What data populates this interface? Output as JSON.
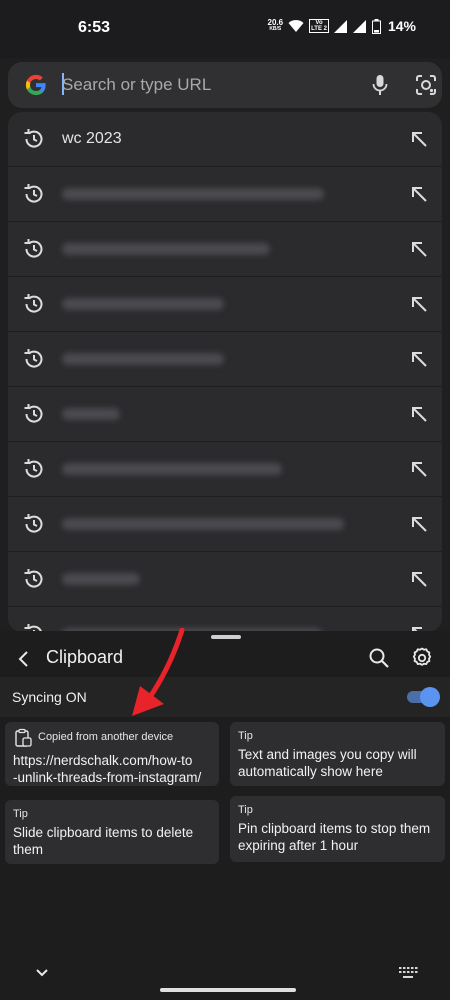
{
  "status_bar": {
    "time": "6:53",
    "net_speed_value": "20.6",
    "net_speed_unit": "KB/S",
    "volte_top": "Vo",
    "volte_bottom": "LTE 2",
    "battery_percent": "14%"
  },
  "search": {
    "placeholder": "Search or type URL",
    "mic_icon": "mic-icon",
    "lens_icon": "lens-icon"
  },
  "suggestions": [
    {
      "text": "wc 2023",
      "blurred": false
    },
    {
      "text": "",
      "blurred": true
    },
    {
      "text": "",
      "blurred": true
    },
    {
      "text": "",
      "blurred": true
    },
    {
      "text": "",
      "blurred": true
    },
    {
      "text": "",
      "blurred": true
    },
    {
      "text": "",
      "blurred": true
    },
    {
      "text": "",
      "blurred": true
    },
    {
      "text": "",
      "blurred": true
    },
    {
      "text": "",
      "blurred": true
    }
  ],
  "clipboard": {
    "title": "Clipboard",
    "sync_label": "Syncing ON",
    "sync_on": true,
    "cards": [
      {
        "label": "Copied from another device",
        "text_line1": "https://nerdschalk.com/how-to",
        "text_line2": "-unlink-threads-from-instagram/"
      },
      {
        "label": "Tip",
        "text_line1": "Text and images you copy will",
        "text_line2": "automatically show here"
      },
      {
        "label": "Tip",
        "text_line1": "Slide clipboard items to delete",
        "text_line2": "them"
      },
      {
        "label": "Tip",
        "text_line1": "Pin clipboard items to stop them",
        "text_line2": "expiring after 1 hour"
      }
    ]
  },
  "colors": {
    "accent": "#8ab4f8",
    "toggle_on": "#5b93f0",
    "annotation_arrow": "#e8232a"
  }
}
